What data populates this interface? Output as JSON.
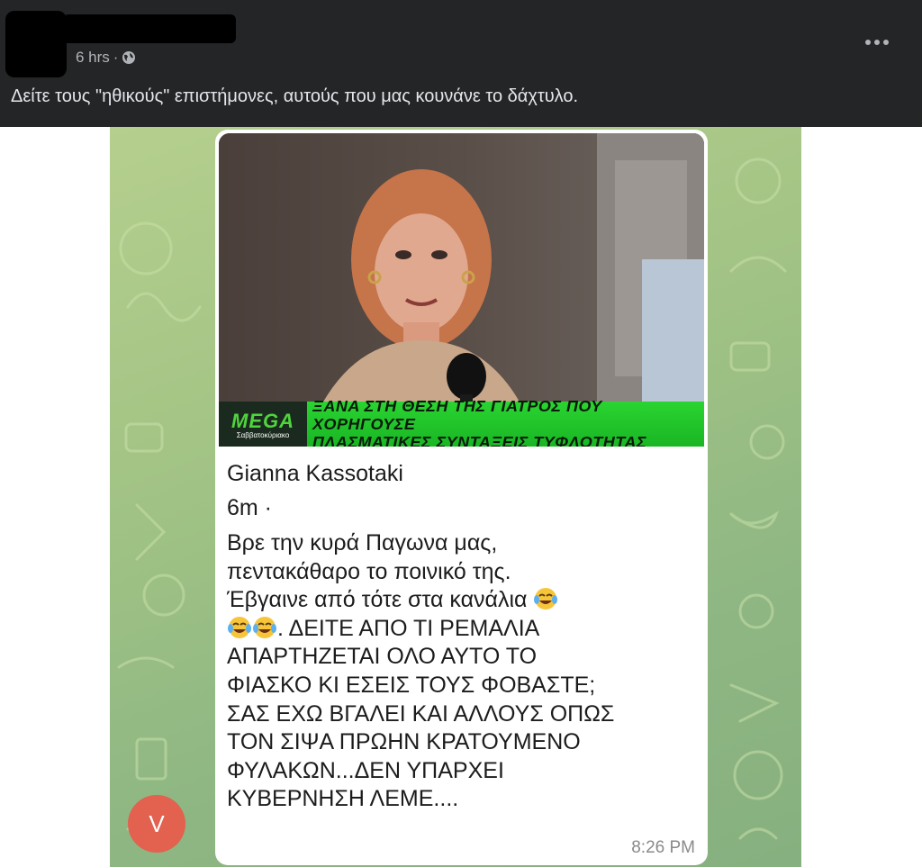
{
  "post": {
    "time": "6 hrs",
    "separator": "·",
    "caption": "Δείτε τους \"ηθικούς\" επιστήμονες, αυτούς που μας κουνάνε το δάχτυλο.",
    "more_label": "•••"
  },
  "screenshot": {
    "ticker": {
      "logo": "MEGA",
      "logo_sub": "Σαββατοκύριακο",
      "line1": "ΞΑΝΑ ΣΤΗ ΘΕΣΗ ΤΗΣ ΓΙΑΤΡΟΣ ΠΟΥ ΧΟΡΗΓΟΥΣΕ",
      "line2": "ΠΛΑΣΜΑΤΙΚΕΣ ΣΥΝΤΑΞΕΙΣ ΤΥΦΛΟΤΗΤΑΣ"
    },
    "message": {
      "author": "Gianna Kassotaki",
      "time_ago": "6m ·",
      "line1": "Βρε την κυρά Παγωνα μας,",
      "line2": "πεντακάθαρο το ποινικό της.",
      "line3": "Έβγαινε από τότε στα κανάλια",
      "line4": ". ΔΕΙΤΕ ΑΠΟ ΤΙ ΡΕΜΑΛΙΑ",
      "line5": "ΑΠΑΡΤΗΖΕΤΑΙ ΟΛΟ ΑΥΤΟ ΤΟ",
      "line6": "ΦΙΑΣΚΟ ΚΙ ΕΣΕΙΣ ΤΟΥΣ ΦΟΒΑΣΤΕ;",
      "line7": "ΣΑΣ ΕΧΩ ΒΓΑΛΕΙ ΚΑΙ ΑΛΛΟΥΣ ΟΠΩΣ",
      "line8": "ΤΟΝ ΣΙΨΑ ΠΡΩΗΝ ΚΡΑΤΟΥΜΕΝΟ",
      "line9": "ΦΥΛΑΚΩΝ...ΔΕΝ ΥΠΑΡΧΕΙ",
      "line10": "ΚΥΒΕΡΝΗΣΗ ΛΕΜΕ....",
      "clock": "8:26 PM"
    },
    "avatar_letter": "V"
  },
  "icons": {
    "globe": "globe-icon",
    "more": "more-options-icon",
    "emoji": "tears-of-joy-emoji-icon"
  },
  "colors": {
    "header_bg": "#242526",
    "chat_bg": "#a3c485",
    "ticker_green": "#2ad431",
    "avatar_red": "#e2614f"
  }
}
